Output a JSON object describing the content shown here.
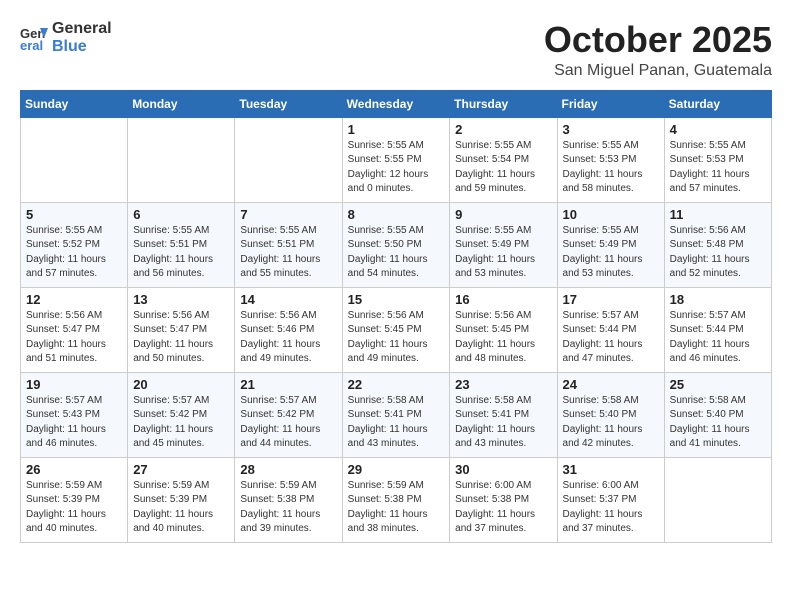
{
  "header": {
    "logo_general": "General",
    "logo_blue": "Blue",
    "month_title": "October 2025",
    "location": "San Miguel Panan, Guatemala"
  },
  "weekdays": [
    "Sunday",
    "Monday",
    "Tuesday",
    "Wednesday",
    "Thursday",
    "Friday",
    "Saturday"
  ],
  "weeks": [
    [
      {
        "day": "",
        "info": ""
      },
      {
        "day": "",
        "info": ""
      },
      {
        "day": "",
        "info": ""
      },
      {
        "day": "1",
        "info": "Sunrise: 5:55 AM\nSunset: 5:55 PM\nDaylight: 12 hours\nand 0 minutes."
      },
      {
        "day": "2",
        "info": "Sunrise: 5:55 AM\nSunset: 5:54 PM\nDaylight: 11 hours\nand 59 minutes."
      },
      {
        "day": "3",
        "info": "Sunrise: 5:55 AM\nSunset: 5:53 PM\nDaylight: 11 hours\nand 58 minutes."
      },
      {
        "day": "4",
        "info": "Sunrise: 5:55 AM\nSunset: 5:53 PM\nDaylight: 11 hours\nand 57 minutes."
      }
    ],
    [
      {
        "day": "5",
        "info": "Sunrise: 5:55 AM\nSunset: 5:52 PM\nDaylight: 11 hours\nand 57 minutes."
      },
      {
        "day": "6",
        "info": "Sunrise: 5:55 AM\nSunset: 5:51 PM\nDaylight: 11 hours\nand 56 minutes."
      },
      {
        "day": "7",
        "info": "Sunrise: 5:55 AM\nSunset: 5:51 PM\nDaylight: 11 hours\nand 55 minutes."
      },
      {
        "day": "8",
        "info": "Sunrise: 5:55 AM\nSunset: 5:50 PM\nDaylight: 11 hours\nand 54 minutes."
      },
      {
        "day": "9",
        "info": "Sunrise: 5:55 AM\nSunset: 5:49 PM\nDaylight: 11 hours\nand 53 minutes."
      },
      {
        "day": "10",
        "info": "Sunrise: 5:55 AM\nSunset: 5:49 PM\nDaylight: 11 hours\nand 53 minutes."
      },
      {
        "day": "11",
        "info": "Sunrise: 5:56 AM\nSunset: 5:48 PM\nDaylight: 11 hours\nand 52 minutes."
      }
    ],
    [
      {
        "day": "12",
        "info": "Sunrise: 5:56 AM\nSunset: 5:47 PM\nDaylight: 11 hours\nand 51 minutes."
      },
      {
        "day": "13",
        "info": "Sunrise: 5:56 AM\nSunset: 5:47 PM\nDaylight: 11 hours\nand 50 minutes."
      },
      {
        "day": "14",
        "info": "Sunrise: 5:56 AM\nSunset: 5:46 PM\nDaylight: 11 hours\nand 49 minutes."
      },
      {
        "day": "15",
        "info": "Sunrise: 5:56 AM\nSunset: 5:45 PM\nDaylight: 11 hours\nand 49 minutes."
      },
      {
        "day": "16",
        "info": "Sunrise: 5:56 AM\nSunset: 5:45 PM\nDaylight: 11 hours\nand 48 minutes."
      },
      {
        "day": "17",
        "info": "Sunrise: 5:57 AM\nSunset: 5:44 PM\nDaylight: 11 hours\nand 47 minutes."
      },
      {
        "day": "18",
        "info": "Sunrise: 5:57 AM\nSunset: 5:44 PM\nDaylight: 11 hours\nand 46 minutes."
      }
    ],
    [
      {
        "day": "19",
        "info": "Sunrise: 5:57 AM\nSunset: 5:43 PM\nDaylight: 11 hours\nand 46 minutes."
      },
      {
        "day": "20",
        "info": "Sunrise: 5:57 AM\nSunset: 5:42 PM\nDaylight: 11 hours\nand 45 minutes."
      },
      {
        "day": "21",
        "info": "Sunrise: 5:57 AM\nSunset: 5:42 PM\nDaylight: 11 hours\nand 44 minutes."
      },
      {
        "day": "22",
        "info": "Sunrise: 5:58 AM\nSunset: 5:41 PM\nDaylight: 11 hours\nand 43 minutes."
      },
      {
        "day": "23",
        "info": "Sunrise: 5:58 AM\nSunset: 5:41 PM\nDaylight: 11 hours\nand 43 minutes."
      },
      {
        "day": "24",
        "info": "Sunrise: 5:58 AM\nSunset: 5:40 PM\nDaylight: 11 hours\nand 42 minutes."
      },
      {
        "day": "25",
        "info": "Sunrise: 5:58 AM\nSunset: 5:40 PM\nDaylight: 11 hours\nand 41 minutes."
      }
    ],
    [
      {
        "day": "26",
        "info": "Sunrise: 5:59 AM\nSunset: 5:39 PM\nDaylight: 11 hours\nand 40 minutes."
      },
      {
        "day": "27",
        "info": "Sunrise: 5:59 AM\nSunset: 5:39 PM\nDaylight: 11 hours\nand 40 minutes."
      },
      {
        "day": "28",
        "info": "Sunrise: 5:59 AM\nSunset: 5:38 PM\nDaylight: 11 hours\nand 39 minutes."
      },
      {
        "day": "29",
        "info": "Sunrise: 5:59 AM\nSunset: 5:38 PM\nDaylight: 11 hours\nand 38 minutes."
      },
      {
        "day": "30",
        "info": "Sunrise: 6:00 AM\nSunset: 5:38 PM\nDaylight: 11 hours\nand 37 minutes."
      },
      {
        "day": "31",
        "info": "Sunrise: 6:00 AM\nSunset: 5:37 PM\nDaylight: 11 hours\nand 37 minutes."
      },
      {
        "day": "",
        "info": ""
      }
    ]
  ]
}
